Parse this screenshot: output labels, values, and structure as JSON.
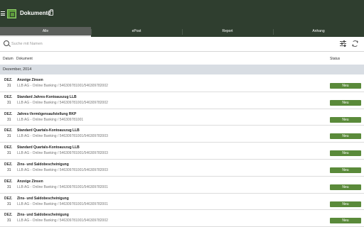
{
  "app": {
    "title": "Dokumente"
  },
  "tabs": [
    {
      "label": "Alle"
    },
    {
      "label": "ePost"
    },
    {
      "label": "Report"
    },
    {
      "label": "Anhang"
    }
  ],
  "search": {
    "placeholder": "Suche mit Namen",
    "value": ""
  },
  "columns": {
    "date": "Datum",
    "document": "Dokument",
    "status": "Status"
  },
  "section": {
    "label": "Dezember, 2014"
  },
  "rows": [
    {
      "month": "DEZ.",
      "day": "31",
      "title": "Anzeige Zinsen",
      "subtitle": "LLB AG - Online Banking / 546309781001/546309782002",
      "status": "Neu"
    },
    {
      "month": "DEZ.",
      "day": "31",
      "title": "Standard Jahres-Kontoauszug LLB",
      "subtitle": "LLB AG - Online Banking / 546309781001/546309782002",
      "status": "Neu"
    },
    {
      "month": "DEZ.",
      "day": "31",
      "title": "Jahres-Vermögensaufstellung RKP",
      "subtitle": "LLB AG - Online Banking / 546309781001",
      "status": "Neu"
    },
    {
      "month": "DEZ.",
      "day": "31",
      "title": "Standard Quartals-Kontoauszug LLB",
      "subtitle": "LLB AG - Online Banking / 546309781001/546309782003",
      "status": "Neu"
    },
    {
      "month": "DEZ.",
      "day": "31",
      "title": "Standard Quartals-Kontoauszug LLB",
      "subtitle": "LLB AG - Online Banking / 546309781001/546309782003",
      "status": "Neu"
    },
    {
      "month": "DEZ.",
      "day": "31",
      "title": "Zins- und Saldobescheinigung",
      "subtitle": "LLB AG - Online Banking / 546309781001/546309782003",
      "status": "Neu"
    },
    {
      "month": "DEZ.",
      "day": "31",
      "title": "Anzeige Zinsen",
      "subtitle": "LLB AG - Online Banking / 546309781001/546309782001",
      "status": "Neu"
    },
    {
      "month": "DEZ.",
      "day": "31",
      "title": "Zins- und Saldobescheinigung",
      "subtitle": "LLB AG - Online Banking / 546309781001/546309782001",
      "status": "Neu"
    },
    {
      "month": "DEZ.",
      "day": "31",
      "title": "Zins- und Saldobescheinigung",
      "subtitle": "LLB AG - Online Banking / 546309781001/546309782002",
      "status": "Neu"
    }
  ],
  "colors": {
    "appbar": "#2f3e2f",
    "accent": "#5a8a3a",
    "section_bg": "#d8dde3"
  },
  "icons": {
    "menu": "hamburger-icon",
    "logo": "app-logo-icon",
    "search": "search-icon",
    "filter": "filter-icon",
    "refresh": "refresh-icon"
  }
}
